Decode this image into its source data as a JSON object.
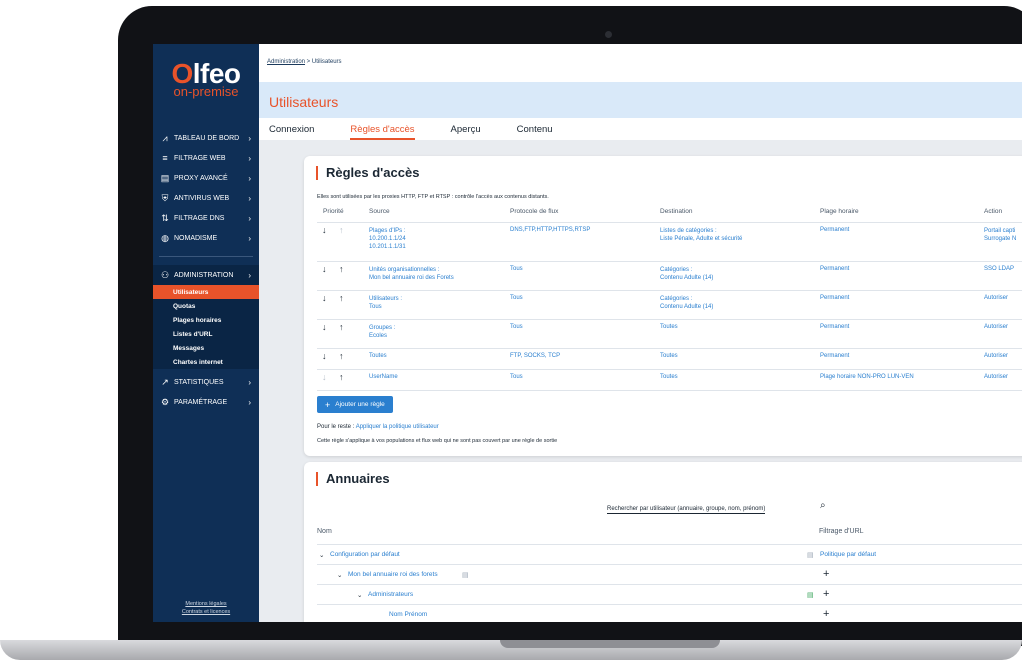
{
  "brand": {
    "name_o": "O",
    "name_rest": "lfeo",
    "edition": "on-premise"
  },
  "sidebar": {
    "items": [
      {
        "icon": "chart-icon",
        "glyph": "⩘",
        "label": "Tableau de bord"
      },
      {
        "icon": "filter-icon",
        "glyph": "≡",
        "label": "Filtrage web"
      },
      {
        "icon": "server-icon",
        "glyph": "▤",
        "label": "Proxy avancé"
      },
      {
        "icon": "shield-icon",
        "glyph": "⛨",
        "label": "Antivirus web"
      },
      {
        "icon": "dns-icon",
        "glyph": "⇅",
        "label": "Filtrage DNS"
      },
      {
        "icon": "globe-icon",
        "glyph": "◍",
        "label": "Nomadisme"
      }
    ],
    "admin": {
      "icon": "users-icon",
      "glyph": "⚇",
      "label": "Administration"
    },
    "admin_sub": [
      "Utilisateurs",
      "Quotas",
      "Plages horaires",
      "Listes d'URL",
      "Messages",
      "Chartes internet"
    ],
    "bottom_items": [
      {
        "icon": "stats-icon",
        "glyph": "↗",
        "label": "Statistiques"
      },
      {
        "icon": "gear-icon",
        "glyph": "⚙",
        "label": "Paramétrage"
      }
    ],
    "legal1": "Mentions légales",
    "legal2": "Contrats et licences"
  },
  "breadcrumb": {
    "root": "Administration",
    "sep": " > ",
    "current": "Utilisateurs"
  },
  "page_title": "Utilisateurs",
  "tabs": [
    "Connexion",
    "Règles d'accès",
    "Aperçu",
    "Contenu"
  ],
  "rules": {
    "title": "Règles d'accès",
    "intro": "Elles sont utilisées par les proxies HTTP, FTP et RTSP : contrôle l'accès aux contenus distants.",
    "columns": [
      "Priorité",
      "Source",
      "Protocole de flux",
      "Destination",
      "Plage horaire",
      "Action"
    ],
    "rows": [
      {
        "source": [
          "Plages d'IPs :",
          "10.200.1.1/24",
          "10.201.1.1/31"
        ],
        "protocol": "DNS,FTP,HTTP,HTTPS,RTSP",
        "destination": [
          "Listes de catégories :",
          "Liste Pénale, Adulte et sécurité"
        ],
        "schedule": "Permanent",
        "action": [
          "Portail capti",
          "Surrogate N"
        ]
      },
      {
        "source": [
          "Unités organisationnelles :",
          "Mon bel annuaire roi des Forets"
        ],
        "protocol": "Tous",
        "destination": [
          "Catégories :",
          "Contenu Adulte (14)"
        ],
        "schedule": "Permanent",
        "action": [
          "SSO LDAP"
        ]
      },
      {
        "source": [
          "Utilisateurs :",
          "Tous"
        ],
        "protocol": "Tous",
        "destination": [
          "Catégories :",
          "Contenu Adulte (14)"
        ],
        "schedule": "Permanent",
        "action": [
          "Autoriser"
        ]
      },
      {
        "source": [
          "Groupes :",
          "Ecoles"
        ],
        "protocol": "Tous",
        "destination": [
          "Toutes"
        ],
        "schedule": "Permanent",
        "action": [
          "Autoriser"
        ]
      },
      {
        "source": [
          "Toutes"
        ],
        "protocol": "FTP, SOCKS, TCP",
        "destination": [
          "Toutes"
        ],
        "schedule": "Permanent",
        "action": [
          "Autoriser"
        ]
      },
      {
        "source": [
          "UserName"
        ],
        "protocol": "Tous",
        "destination": [
          "Toutes"
        ],
        "schedule": "Plage horaire NON-PRO LUN-VEN",
        "action": [
          "Autoriser"
        ]
      }
    ],
    "add_button": "Ajouter une règle",
    "rest_label": "Pour le reste : ",
    "rest_link": "Appliquer la politique utilisateur",
    "rest_note": "Cette règle s'applique à vos populations et flux web qui ne sont pas couvert par une règle de sortie"
  },
  "directories": {
    "title": "Annuaires",
    "search_placeholder": "Rechercher par utilisateur (annuaire, groupe, nom, prénom)",
    "col_name": "Nom",
    "col_filter": "Filtrage d'URL",
    "rows": [
      {
        "label": "Configuration par défaut",
        "filter": "Politique par défaut"
      },
      {
        "label": "Mon bel annuaire roi des forets",
        "filter": "+"
      },
      {
        "label": "Administrateurs",
        "filter": "+"
      },
      {
        "label": "Nom Prénom",
        "filter": "+"
      }
    ]
  }
}
